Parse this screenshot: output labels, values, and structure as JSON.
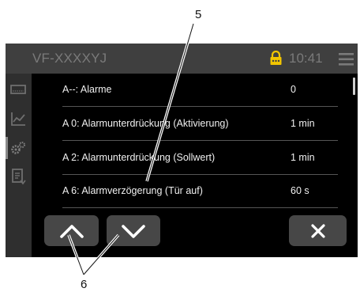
{
  "callouts": {
    "top": "5",
    "bottom": "6"
  },
  "header": {
    "title": "VF-XXXXYJ",
    "time": "10:41",
    "lock_color": "#f2c500"
  },
  "sidebar": {
    "items": [
      {
        "icon": "display-icon"
      },
      {
        "icon": "chart-icon"
      },
      {
        "icon": "gears-icon",
        "active": true
      },
      {
        "icon": "document-icon"
      }
    ]
  },
  "list": {
    "rows": [
      {
        "label": "A--: Alarme",
        "value": "0"
      },
      {
        "label": "A 0: Alarmunterdrückung (Aktivierung)",
        "value": "1 min"
      },
      {
        "label": "A 2: Alarmunterdrückung (Sollwert)",
        "value": "1 min"
      },
      {
        "label": "A 6: Alarmverzögerung (Tür auf)",
        "value": "60 s"
      }
    ]
  },
  "buttons": {
    "up": "chevron-up-icon",
    "down": "chevron-down-icon",
    "close": "close-icon"
  }
}
